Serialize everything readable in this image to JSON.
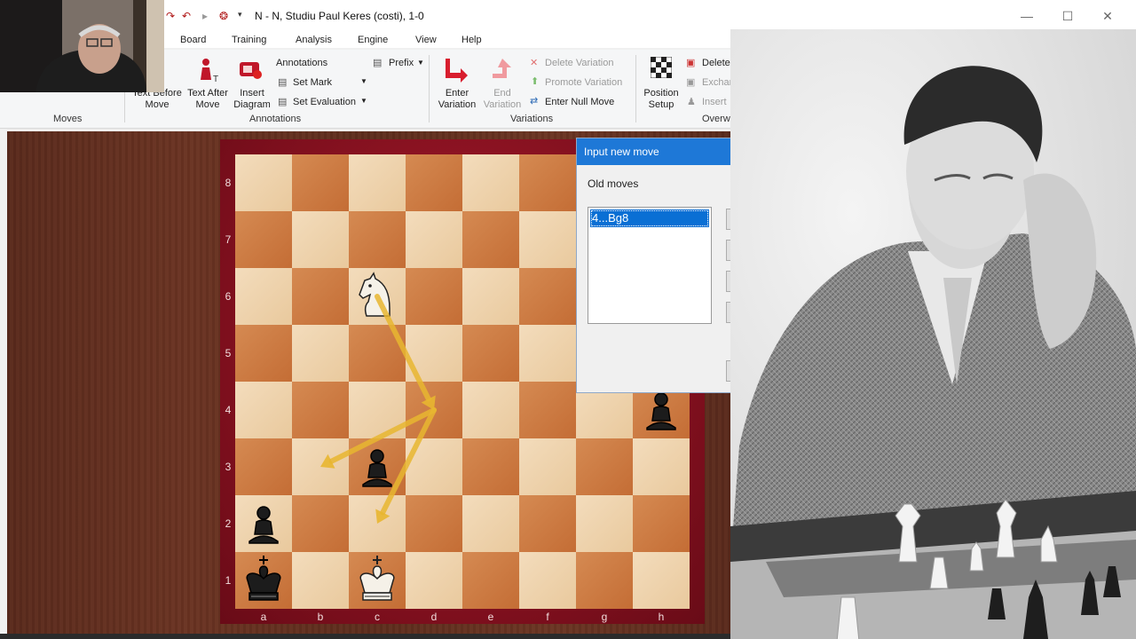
{
  "window": {
    "title": "N - N, Studiu Paul Keres  (costi), 1-0",
    "controls": {
      "minimize": "—",
      "maximize": "☐",
      "close": "✕"
    }
  },
  "menu": [
    "Board",
    "Training",
    "Analysis",
    "Engine",
    "View",
    "Help"
  ],
  "ribbon": {
    "moves_group": "Moves",
    "text_before_move": "Text Before\nMove",
    "text_after_move": "Text After\nMove",
    "insert_diagram": "Insert\nDiagram",
    "annotations": "Annotations",
    "set_mark": "Set Mark",
    "set_evaluation": "Set Evaluation",
    "prefix": "Prefix",
    "annotations_group": "Annotations",
    "enter_variation": "Enter\nVariation",
    "end_variation": "End\nVariation",
    "delete_variation": "Delete Variation",
    "promote_variation": "Promote Variation",
    "enter_null_move": "Enter Null Move",
    "variations_group": "Variations",
    "position_setup": "Position\nSetup",
    "delete": "Delete",
    "exchange": "Exchange",
    "insert": "Insert",
    "overwrite_group": "Overwr"
  },
  "board": {
    "ranks": [
      "8",
      "7",
      "6",
      "5",
      "4",
      "3",
      "2",
      "1"
    ],
    "files": [
      "a",
      "b",
      "c",
      "d",
      "e",
      "f",
      "g",
      "h"
    ],
    "pieces": [
      {
        "square": "c6",
        "piece": "white-knight"
      },
      {
        "square": "h4",
        "piece": "black-pawn"
      },
      {
        "square": "c3",
        "piece": "black-pawn"
      },
      {
        "square": "a2",
        "piece": "black-pawn"
      },
      {
        "square": "a1",
        "piece": "black-king"
      },
      {
        "square": "c1",
        "piece": "white-king"
      }
    ],
    "arrows": [
      {
        "from": "c6",
        "to": "d4"
      },
      {
        "from": "d4",
        "to": "b3"
      },
      {
        "from": "d4",
        "to": "c2"
      }
    ],
    "arrow_color": "#e8b630"
  },
  "dialog": {
    "title": "Input new move",
    "old_moves_label": "Old moves",
    "moves": [
      "4...Bg8"
    ]
  },
  "colors": {
    "accent": "#1e78d7",
    "board_frame": "#8b1424",
    "light_square": "#f0d7b3",
    "dark_square": "#cf7d45"
  }
}
